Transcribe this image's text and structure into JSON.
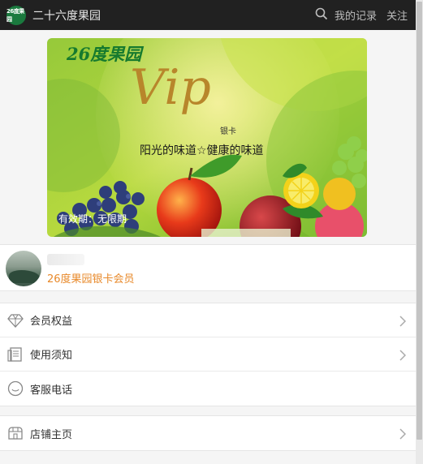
{
  "header": {
    "logo_text": "26度果园",
    "shop_name": "二十六度果园",
    "my_records": "我的记录",
    "follow": "关注"
  },
  "card": {
    "brand": "26度果园",
    "vip_text": "Vip",
    "card_type": "银卡",
    "slogan": "阳光的味道☆健康的味道",
    "validity": "有效期：无限期"
  },
  "member": {
    "level": "26度果园银卡会员"
  },
  "menu": {
    "benefits": "会员权益",
    "notice": "使用须知",
    "service": "客服电话",
    "shop_home": "店铺主页"
  },
  "colors": {
    "topbar": "#212121",
    "accent_orange": "#e8892a",
    "brand_green": "#167a2e",
    "vip_gold": "#b8862b"
  },
  "icons": {
    "search": "search-icon",
    "benefits": "diamond-icon",
    "notice": "document-icon",
    "service": "chat-bubble-icon",
    "shop_home": "store-icon",
    "chevron": "chevron-right-icon"
  }
}
